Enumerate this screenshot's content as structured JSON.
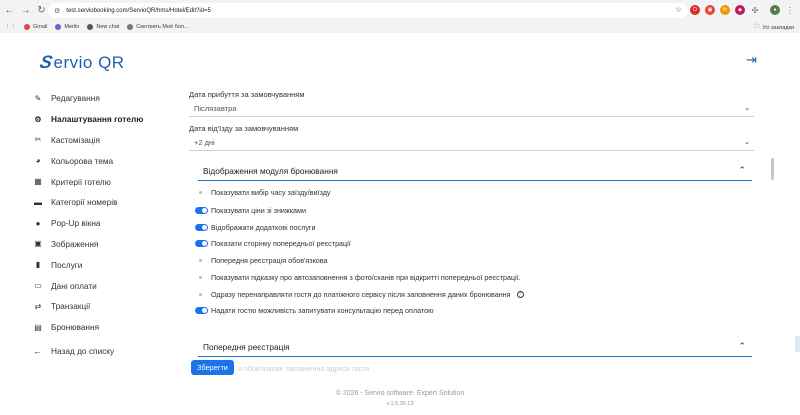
{
  "browser": {
    "url": "test.serviobooking.com/ServioQR/hms/Hotel/Edit?id=5",
    "bookmarks": [
      "Gmail",
      "Merlin",
      "New chat",
      "Смотреть Моё бол..."
    ],
    "all_bookmarks": "Усі закладки"
  },
  "logo": {
    "text": "ervio QR",
    "mark": "S"
  },
  "sidebar": {
    "items": [
      {
        "label": "Редагування",
        "icon": "pencil-icon"
      },
      {
        "label": "Налаштування готелю",
        "icon": "gear-icon",
        "active": true
      },
      {
        "label": "Кастомізація",
        "icon": "tools-icon"
      },
      {
        "label": "Кольорова тема",
        "icon": "palette-icon"
      },
      {
        "label": "Критерії готелю",
        "icon": "table-icon"
      },
      {
        "label": "Категорії номерів",
        "icon": "folder-icon"
      },
      {
        "label": "Pop-Up вікна",
        "icon": "chat-icon"
      },
      {
        "label": "Зображення",
        "icon": "images-icon"
      },
      {
        "label": "Послуги",
        "icon": "book-icon"
      },
      {
        "label": "Дані оплати",
        "icon": "card-icon"
      },
      {
        "label": "Транзакції",
        "icon": "transactions-icon"
      },
      {
        "label": "Бронювання",
        "icon": "booking-icon"
      }
    ],
    "back": "Назад до списку"
  },
  "form": {
    "arrival_label": "Дата прибуття за замовчуванням",
    "arrival_value": "Післязавтра",
    "departure_label": "Дата від'їзду за замовчуванням",
    "departure_value": "+2 дні"
  },
  "booking_module": {
    "title": "Відображення модуля бронювання",
    "options": [
      {
        "label": "Показувати вибір часу заїзду/виїзду",
        "on": false
      },
      {
        "label": "Показувати ціни зі знижками",
        "on": true
      },
      {
        "label": "Відображати додаткові послуги",
        "on": true
      },
      {
        "label": "Показати сторінку попередньої реєстрації",
        "on": true
      },
      {
        "label": "Попередня реєстрація обов'язкова",
        "on": false
      },
      {
        "label": "Показувати підказку про автозаповнення з фото/сканів при відкритті попередньої реєстрації.",
        "on": false
      },
      {
        "label": "Одразу перенаправляти гостя до платіжного сервісу після заповнення даних бронювання",
        "on": false,
        "help": true
      },
      {
        "label": "Надати гостю можливість запитувати консультацію перед оплатою",
        "on": true
      }
    ]
  },
  "pre_registration": {
    "title": "Попередня реєстрація",
    "faded_text": "и обов'язкове заповнення адреси гостя"
  },
  "save_label": "Зберегти",
  "footer": {
    "copyright": "© 2026 - Servio software. Expert Solution",
    "version": "v.1.5.36.13"
  }
}
